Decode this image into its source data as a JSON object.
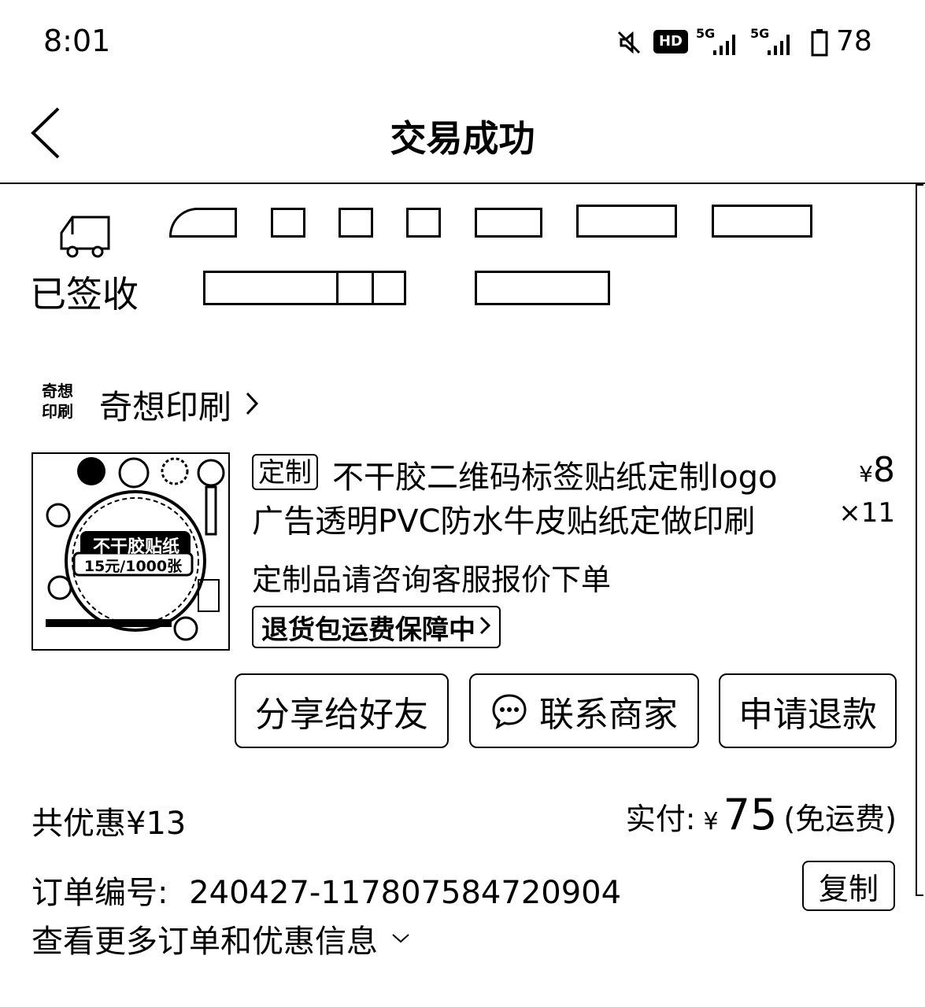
{
  "status_bar": {
    "time": "8:01",
    "hd_label": "HD",
    "net1": "5G",
    "net2": "5G",
    "battery": "78"
  },
  "header": {
    "title": "交易成功"
  },
  "logistics": {
    "status": "已签收"
  },
  "shop": {
    "name": "奇想印刷",
    "logo_text": "奇想印刷"
  },
  "product": {
    "tag": "定制",
    "title_line1": "不干胶二维码标签贴纸定制logo",
    "title_line2": "广告透明PVC防水牛皮贴纸定做印刷",
    "currency": "¥",
    "price": "8",
    "quantity": "×11",
    "spec": "定制品请咨询客服报价下单",
    "return_badge": "退货包运费保障中",
    "thumb": {
      "line1": "不干胶贴纸",
      "line2": "15元/1000张"
    }
  },
  "actions": {
    "share": "分享给好友",
    "contact": "联系商家",
    "refund": "申请退款"
  },
  "summary": {
    "discount": "共优惠¥13",
    "paid_label": "实付:",
    "currency": "¥",
    "paid_amount": "75",
    "shipping_note": "(免运费)"
  },
  "order": {
    "number_label": "订单编号:",
    "number": "240427-117807584720904",
    "copy": "复制",
    "more": "查看更多订单和优惠信息"
  }
}
